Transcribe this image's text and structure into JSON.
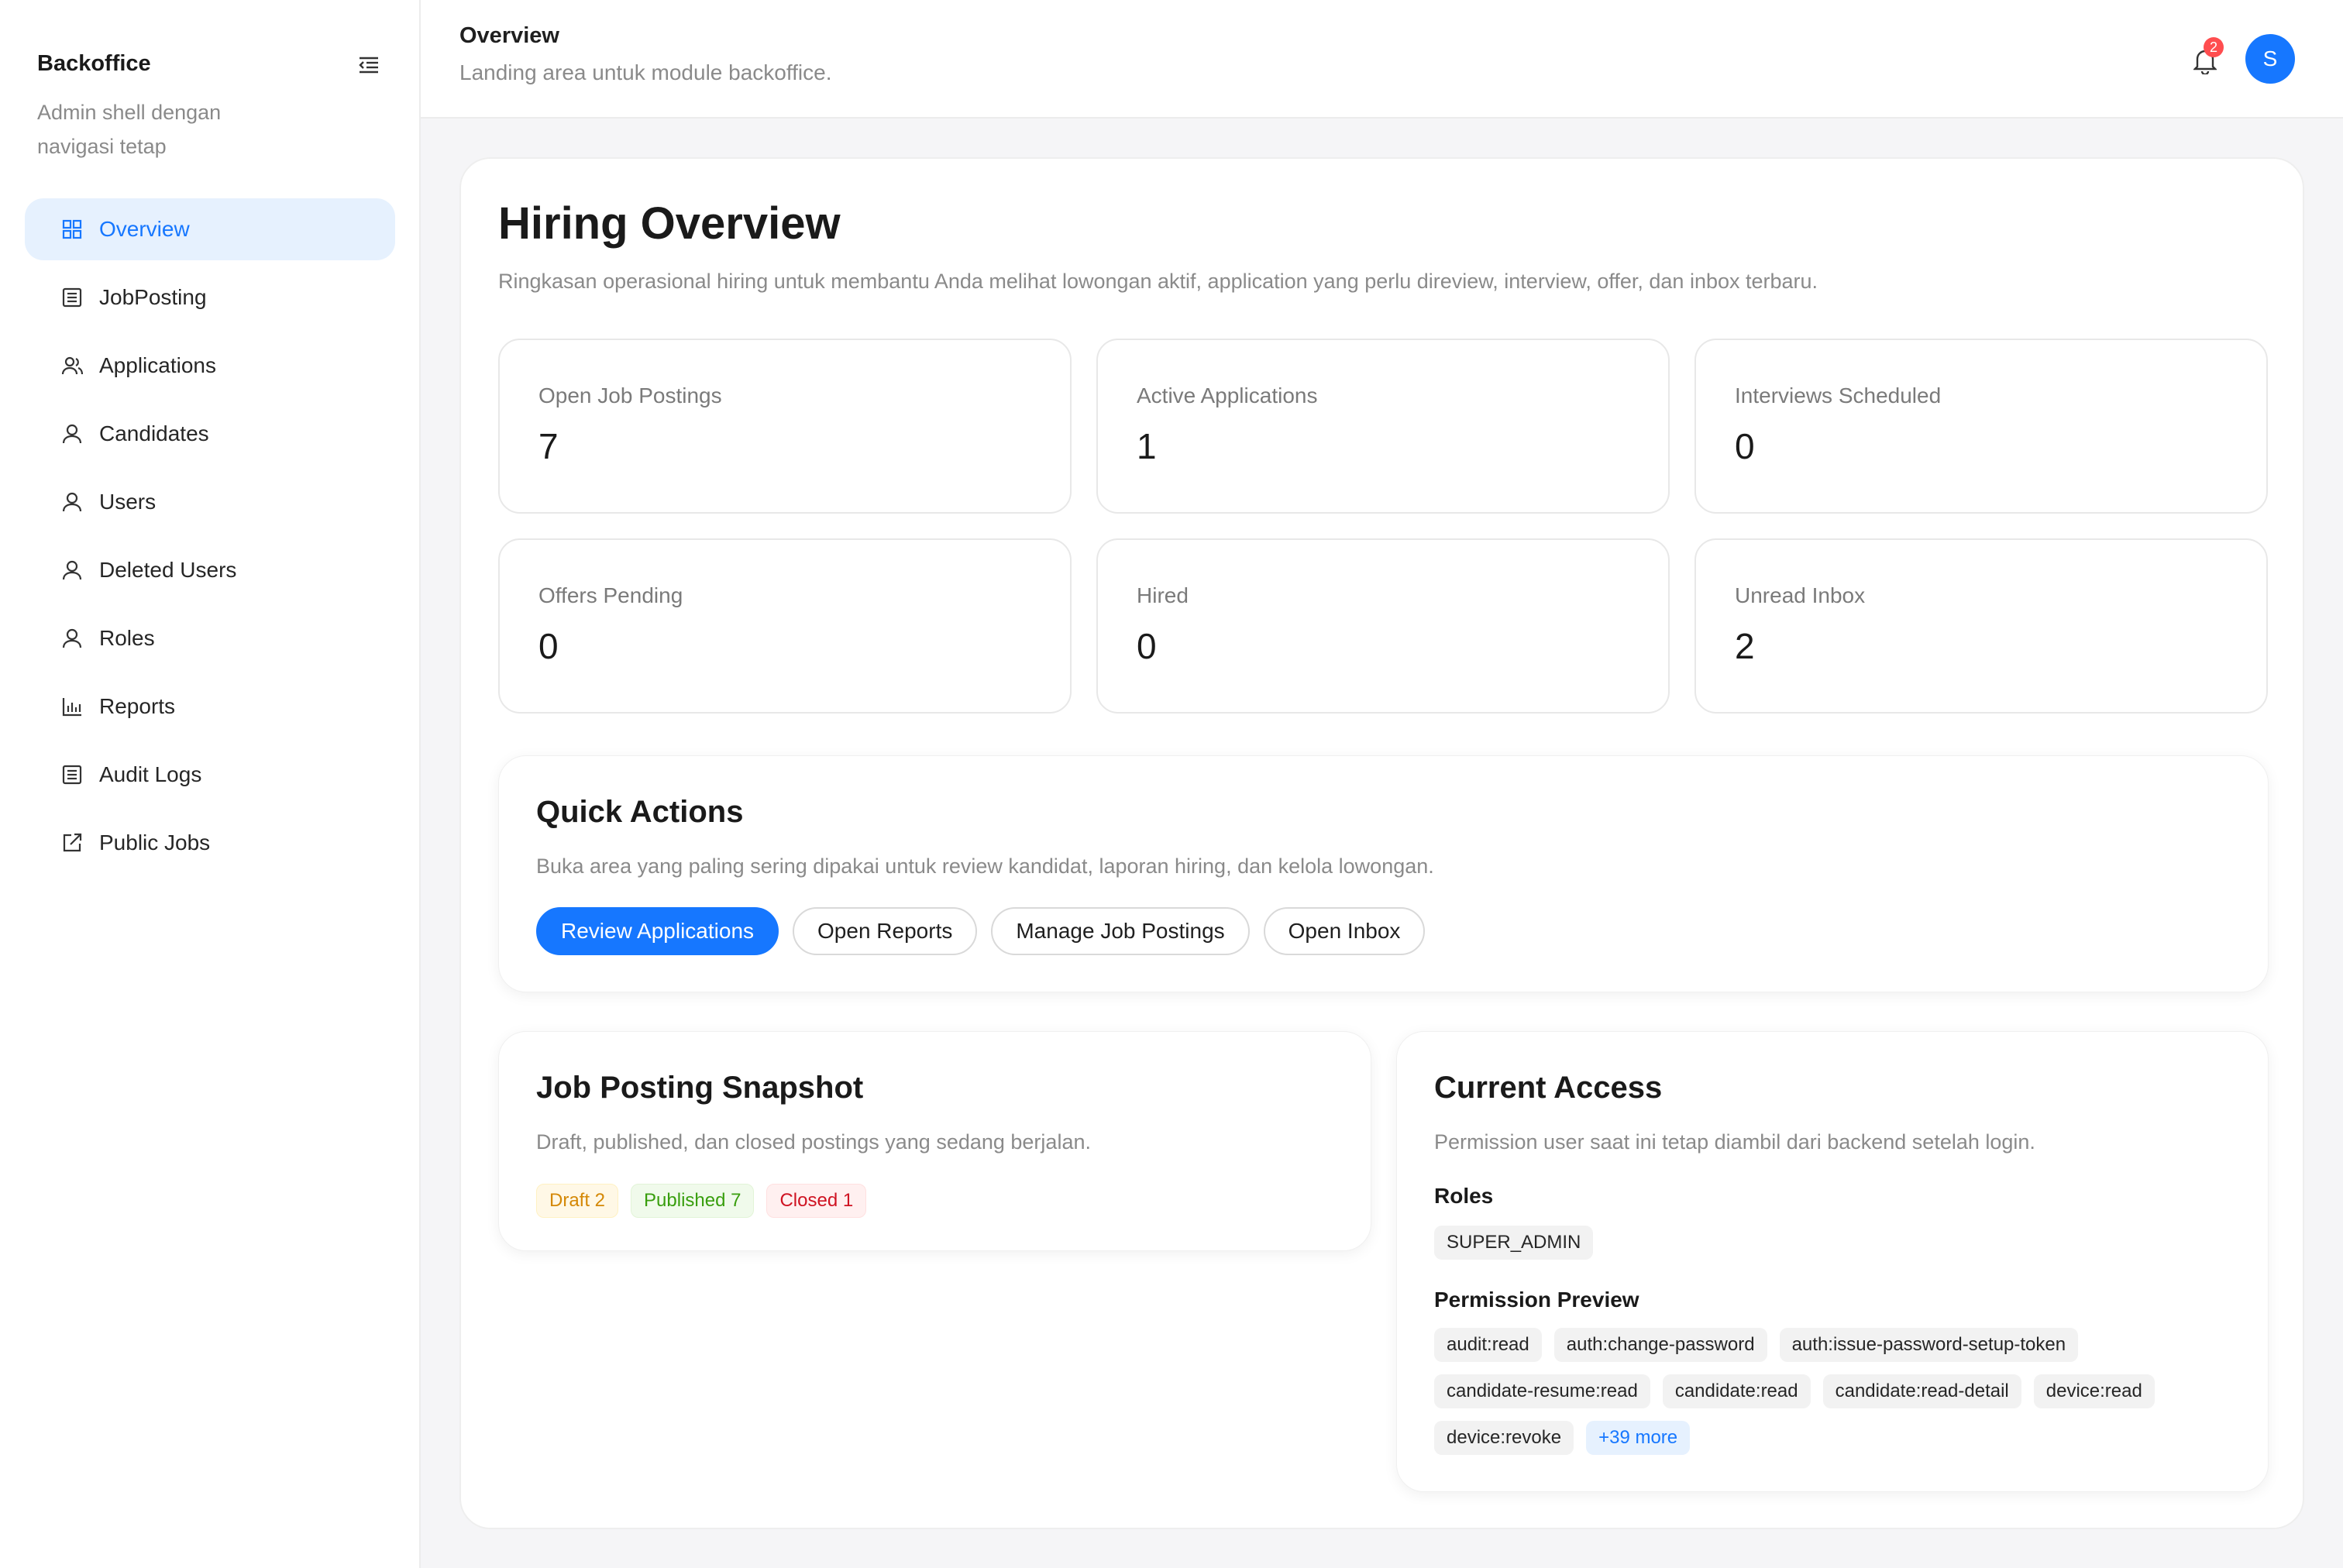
{
  "sidebar": {
    "brand_title": "Backoffice",
    "brand_subtitle": "Admin shell dengan navigasi tetap",
    "items": [
      {
        "label": "Overview",
        "icon": "grid-icon"
      },
      {
        "label": "JobPosting",
        "icon": "list-icon"
      },
      {
        "label": "Applications",
        "icon": "people-icon"
      },
      {
        "label": "Candidates",
        "icon": "user-icon"
      },
      {
        "label": "Users",
        "icon": "user-icon"
      },
      {
        "label": "Deleted Users",
        "icon": "user-icon"
      },
      {
        "label": "Roles",
        "icon": "user-icon"
      },
      {
        "label": "Reports",
        "icon": "bar-chart-icon"
      },
      {
        "label": "Audit Logs",
        "icon": "list-icon"
      },
      {
        "label": "Public Jobs",
        "icon": "external-link-icon"
      }
    ]
  },
  "header": {
    "title": "Overview",
    "subtitle": "Landing area untuk module backoffice.",
    "notification_count": "2",
    "avatar_initial": "S"
  },
  "overview": {
    "title": "Hiring Overview",
    "description": "Ringkasan operasional hiring untuk membantu Anda melihat lowongan aktif, application yang perlu direview, interview, offer, dan inbox terbaru.",
    "stats": [
      {
        "label": "Open Job Postings",
        "value": "7"
      },
      {
        "label": "Active Applications",
        "value": "1"
      },
      {
        "label": "Interviews Scheduled",
        "value": "0"
      },
      {
        "label": "Offers Pending",
        "value": "0"
      },
      {
        "label": "Hired",
        "value": "0"
      },
      {
        "label": "Unread Inbox",
        "value": "2"
      }
    ]
  },
  "quick_actions": {
    "title": "Quick Actions",
    "description": "Buka area yang paling sering dipakai untuk review kandidat, laporan hiring, dan kelola lowongan.",
    "buttons": [
      "Review Applications",
      "Open Reports",
      "Manage Job Postings",
      "Open Inbox"
    ]
  },
  "snapshot": {
    "title": "Job Posting Snapshot",
    "description": "Draft, published, dan closed postings yang sedang berjalan.",
    "draft": "Draft 2",
    "published": "Published 7",
    "closed": "Closed 1"
  },
  "access": {
    "title": "Current Access",
    "description": "Permission user saat ini tetap diambil dari backend setelah login.",
    "roles_heading": "Roles",
    "roles": [
      "SUPER_ADMIN"
    ],
    "permissions_heading": "Permission Preview",
    "permissions": [
      "audit:read",
      "auth:change-password",
      "auth:issue-password-setup-token",
      "candidate-resume:read",
      "candidate:read",
      "candidate:read-detail",
      "device:read",
      "device:revoke"
    ],
    "more": "+39 more"
  },
  "colors": {
    "accent": "#1677ff",
    "badge": "#ff4d4f"
  }
}
